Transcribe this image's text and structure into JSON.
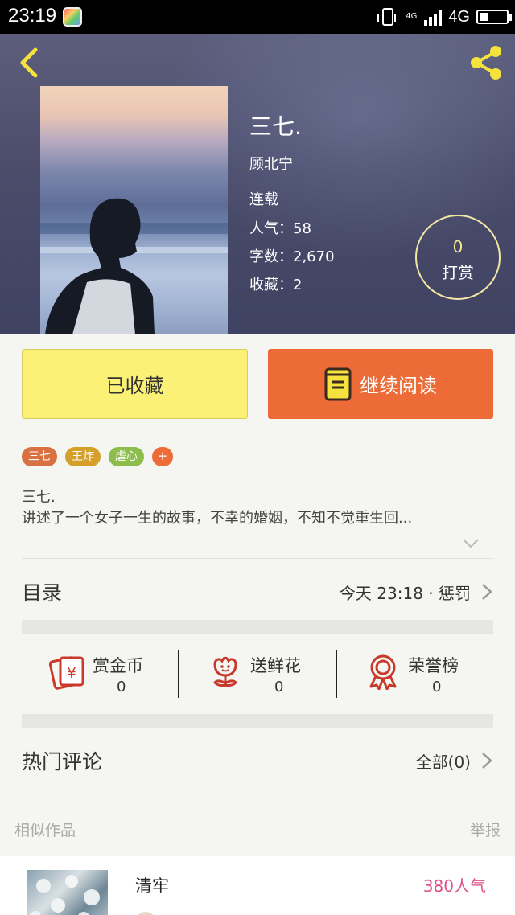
{
  "status_bar": {
    "time": "23:19",
    "network_small": "4G",
    "network": "4G"
  },
  "book": {
    "title": "三七.",
    "author": "顾北宁",
    "status": "连载",
    "popularity_label": "人气：",
    "popularity": "58",
    "words_label": "字数：",
    "words": "2,670",
    "favorites_label": "收藏：",
    "favorites": "2"
  },
  "tip": {
    "count": "0",
    "label": "打赏"
  },
  "actions": {
    "favorited_label": "已收藏",
    "continue_label": "继续阅读"
  },
  "tags": [
    {
      "label": "三七",
      "color": "#d8703f"
    },
    {
      "label": "王炸",
      "color": "#d4a029"
    },
    {
      "label": "虐心",
      "color": "#8dbd4b"
    }
  ],
  "tag_more": "+",
  "description": {
    "line1": "三七.",
    "line2": "讲述了一个女子一生的故事，不幸的婚姻，不知不觉重生回..."
  },
  "toc": {
    "label": "目录",
    "latest": "今天 23:18 · 惩罚"
  },
  "support": [
    {
      "name": "赏金币",
      "value": "0",
      "icon": "red-envelope-icon"
    },
    {
      "name": "送鲜花",
      "value": "0",
      "icon": "flower-icon"
    },
    {
      "name": "荣誉榜",
      "value": "0",
      "icon": "medal-icon"
    }
  ],
  "comments": {
    "label": "热门评论",
    "all": "全部(0)"
  },
  "similar": {
    "heading": "相似作品",
    "report": "举报",
    "items": [
      {
        "title": "清牢",
        "popularity": "380人气"
      }
    ]
  },
  "colors": {
    "accent_orange": "#ec6b37",
    "fav_yellow": "#fbf176",
    "icon_yellow": "#f5e23c",
    "icon_red": "#c9392b"
  }
}
